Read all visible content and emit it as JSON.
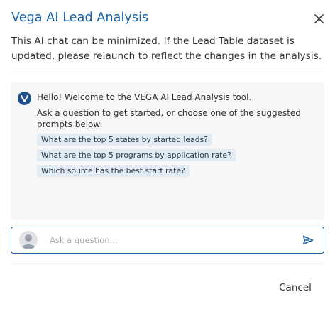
{
  "dialog": {
    "title": "Vega AI Lead Analysis",
    "description": "This AI chat can be minimized. If the Lead Table dataset is updated, please relaunch to reflect the changes in the analysis.",
    "close_icon": "close-icon"
  },
  "chat": {
    "bot_avatar_icon": "vega-logo-icon",
    "greeting": "Hello! Welcome to the VEGA AI Lead Analysis tool.",
    "instruction": "Ask a question to get started, or choose one of the suggested prompts below:",
    "suggested_prompts": [
      {
        "label": "What are the top 5 states by started leads?"
      },
      {
        "label": "What are the top 5 programs by application rate?"
      },
      {
        "label": "Which source has the best start rate?"
      }
    ]
  },
  "input": {
    "value": "",
    "placeholder": "Ask a question...",
    "avatar_icon": "user-avatar-icon",
    "send_icon": "send-icon"
  },
  "footer": {
    "cancel_label": "Cancel"
  },
  "colors": {
    "title": "#1662a8",
    "input_border": "#1d5fa3",
    "chip_background": "#e3ecf5",
    "panel_background": "#f7f7f8",
    "send_icon": "#1d5fa3"
  }
}
